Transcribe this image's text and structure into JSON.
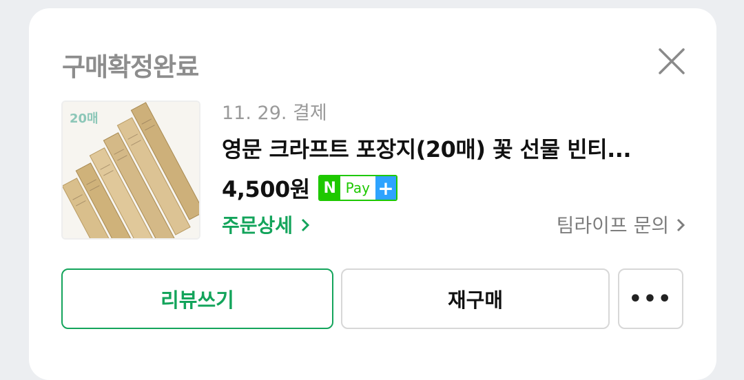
{
  "order": {
    "status": "구매확정완료",
    "thumbnail_badge": "20매",
    "date": "11. 29. 결제",
    "product_title": "영문 크라프트 포장지(20매) 꽃 선물 빈티...",
    "price": "4,500원",
    "npay": {
      "n": "N",
      "text": "Pay",
      "plus": "+"
    },
    "detail_link": "주문상세",
    "inquiry_link": "팀라이프 문의"
  },
  "buttons": {
    "review": "리뷰쓰기",
    "rebuy": "재구매",
    "more": "•••"
  },
  "icons": {
    "close": "close-icon",
    "chevron": "chevron-right-icon"
  },
  "colors": {
    "accent": "#13a45b",
    "npay_green": "#1ec800",
    "npay_blue": "#2ea3ff",
    "muted": "#8d8d8d"
  }
}
